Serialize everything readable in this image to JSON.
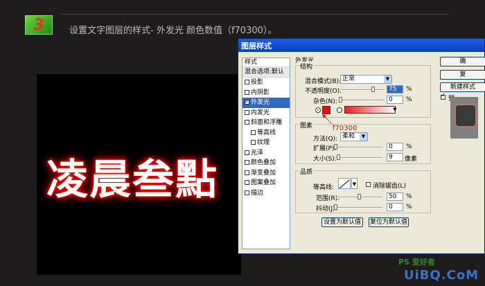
{
  "step": {
    "number": "3",
    "text": "设置文字图层的样式- 外发光 颜色数值（f70300）。"
  },
  "canvas": {
    "text": "凌晨叁點"
  },
  "dialog": {
    "title": "图层样式",
    "styles_header": "样式",
    "blend_item": "混合选项:默认",
    "styles": [
      {
        "label": "投影",
        "checked": false
      },
      {
        "label": "内阴影",
        "checked": false
      },
      {
        "label": "外发光",
        "checked": true,
        "selected": true
      },
      {
        "label": "内发光",
        "checked": false
      },
      {
        "label": "斜面和浮雕",
        "checked": false
      },
      {
        "label": "等高线",
        "checked": false,
        "indent": true
      },
      {
        "label": "纹理",
        "checked": false,
        "indent": true
      },
      {
        "label": "光泽",
        "checked": false
      },
      {
        "label": "颜色叠加",
        "checked": false
      },
      {
        "label": "渐变叠加",
        "checked": false
      },
      {
        "label": "图案叠加",
        "checked": false
      },
      {
        "label": "描边",
        "checked": false
      }
    ],
    "panel_title": "外发光",
    "structure": {
      "label": "结构",
      "blend_mode_label": "混合模式(B):",
      "blend_mode_value": "正常",
      "opacity_label": "不透明度(O):",
      "opacity_value": "75",
      "noise_label": "杂色(N):",
      "noise_value": "0",
      "unit": "%",
      "opacity_fraction": 0.75,
      "noise_fraction": 0
    },
    "elements": {
      "label": "图素",
      "method_label": "方法(Q):",
      "method_value": "柔和",
      "spread_label": "扩展(P):",
      "spread_value": "0",
      "size_label": "大小(S):",
      "size_value": "9",
      "size_unit": "像素",
      "unit": "%"
    },
    "quality": {
      "label": "品质",
      "contour_label": "等高线:",
      "antialias_label": "消除锯齿(L)",
      "range_label": "范围(R):",
      "range_value": "50",
      "jitter_label": "抖动(J):",
      "jitter_value": "0",
      "unit": "%"
    },
    "default_button": "设置为默认值",
    "reset_button": "复位为默认值",
    "right_buttons": {
      "ok": "确",
      "reset": "复",
      "new_style": "新建样式",
      "preview": "预"
    },
    "glow_color": "#f70300",
    "annotation": "f70300"
  },
  "watermark": {
    "top": "PS 爱好者",
    "bottom": "UiBQ.CoM"
  }
}
